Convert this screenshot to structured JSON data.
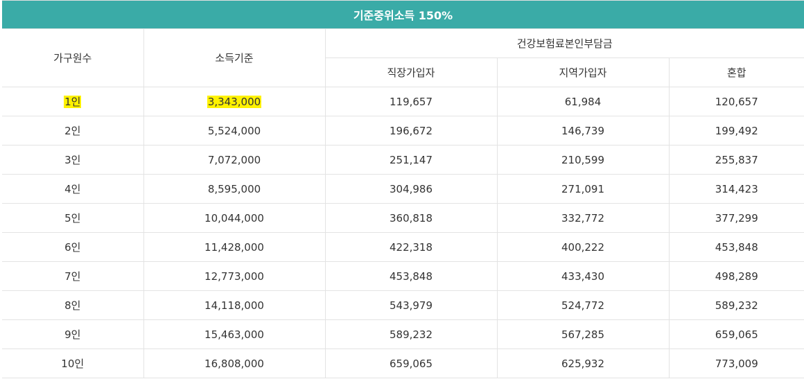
{
  "title": "기준중위소득 150%",
  "headers": {
    "household": "가구원수",
    "income": "소득기준",
    "insurance_group": "건강보험료본인부담금",
    "employee": "직장가입자",
    "regional": "지역가입자",
    "mixed": "혼합"
  },
  "rows": [
    {
      "household": "1인",
      "income": "3,343,000",
      "employee": "119,657",
      "regional": "61,984",
      "mixed": "120,657"
    },
    {
      "household": "2인",
      "income": "5,524,000",
      "employee": "196,672",
      "regional": "146,739",
      "mixed": "199,492"
    },
    {
      "household": "3인",
      "income": "7,072,000",
      "employee": "251,147",
      "regional": "210,599",
      "mixed": "255,837"
    },
    {
      "household": "4인",
      "income": "8,595,000",
      "employee": "304,986",
      "regional": "271,091",
      "mixed": "314,423"
    },
    {
      "household": "5인",
      "income": "10,044,000",
      "employee": "360,818",
      "regional": "332,772",
      "mixed": "377,299"
    },
    {
      "household": "6인",
      "income": "11,428,000",
      "employee": "422,318",
      "regional": "400,222",
      "mixed": "453,848"
    },
    {
      "household": "7인",
      "income": "12,773,000",
      "employee": "453,848",
      "regional": "433,430",
      "mixed": "498,289"
    },
    {
      "household": "8인",
      "income": "14,118,000",
      "employee": "543,979",
      "regional": "524,772",
      "mixed": "589,232"
    },
    {
      "household": "9인",
      "income": "15,463,000",
      "employee": "589,232",
      "regional": "567,285",
      "mixed": "659,065"
    },
    {
      "household": "10인",
      "income": "16,808,000",
      "employee": "659,065",
      "regional": "625,932",
      "mixed": "773,009"
    }
  ],
  "colors": {
    "title_bg": "#3aaba7",
    "highlight": "#fff200",
    "border": "#e3e3e3"
  }
}
